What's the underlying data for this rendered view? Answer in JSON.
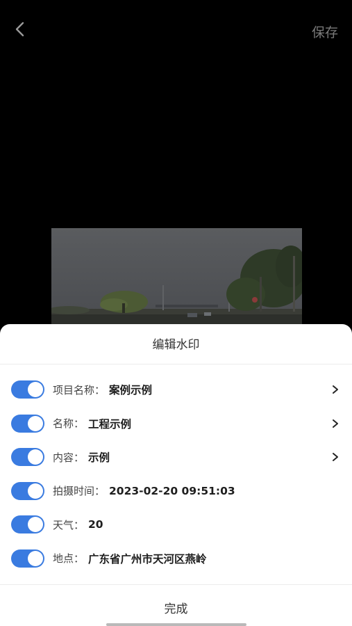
{
  "header": {
    "back_icon": "chevron-left-icon",
    "save_label": "保存"
  },
  "sheet": {
    "title": "编辑水印",
    "rows": [
      {
        "enabled": true,
        "label": "项目名称：",
        "value": "案例示例",
        "has_chevron": true
      },
      {
        "enabled": true,
        "label": "名称：",
        "value": "工程示例",
        "has_chevron": true
      },
      {
        "enabled": true,
        "label": "内容：",
        "value": "示例",
        "has_chevron": true
      },
      {
        "enabled": true,
        "label": "拍摄时间：",
        "value": "2023-02-20 09:51:03",
        "has_chevron": false
      },
      {
        "enabled": true,
        "label": "天气：",
        "value": "20",
        "has_chevron": false
      },
      {
        "enabled": true,
        "label": "地点：",
        "value": "广东省广州市天河区燕岭",
        "has_chevron": false
      }
    ]
  },
  "footer": {
    "done_label": "完成"
  },
  "colors": {
    "toggle_on": "#3a7be0",
    "save_text": "#7a7a7a"
  }
}
